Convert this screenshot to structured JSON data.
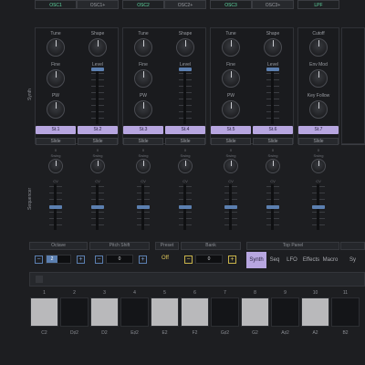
{
  "side_labels": {
    "synth": "Synth",
    "sequencer": "Sequencer"
  },
  "modules": [
    {
      "tabs": [
        "OSC1",
        "OSC1+"
      ],
      "active_tab": 0,
      "knobs": [
        "Tune",
        "Fine",
        "PW"
      ],
      "right_knob": "Shape",
      "right_fader": "Level",
      "steps": [
        "St.1",
        "St.2"
      ]
    },
    {
      "tabs": [
        "OSC2",
        "OSC2+"
      ],
      "active_tab": 0,
      "knobs": [
        "Tune",
        "Fine",
        "PW"
      ],
      "right_knob": "Shape",
      "right_fader": "Level",
      "steps": [
        "St.3",
        "St.4"
      ]
    },
    {
      "tabs": [
        "OSC3",
        "OSC3+"
      ],
      "active_tab": 0,
      "knobs": [
        "Tune",
        "Fine",
        "PW"
      ],
      "right_knob": "Shape",
      "right_fader": "Level",
      "steps": [
        "St.5",
        "St.6"
      ]
    },
    {
      "tabs": [
        "LPF"
      ],
      "active_tab": 0,
      "knobs": [
        "Cutoff",
        "Env Mod",
        "Key Follow"
      ],
      "steps": [
        "St.7"
      ]
    }
  ],
  "slide_label": "Slide",
  "seq_tiny_labels": {
    "top": "0",
    "sub": "Swing",
    "cv": "CV"
  },
  "bottom": {
    "octave_label": "Octave",
    "pitch_shift_label": "Pitch Shift",
    "preset_label": "Preset",
    "bank_label": "Bank",
    "top_panel_label": "Top Panel",
    "octave_value": "2",
    "pitch_value": "0",
    "preset_value": "Off",
    "bank_value": "0",
    "minus": "−",
    "plus": "+",
    "nav_tabs": [
      "Synth",
      "Seq",
      "LFO",
      "Effects",
      "Macro",
      "Sy"
    ],
    "active_nav": 0
  },
  "keyboard": {
    "numbers": [
      "1",
      "2",
      "3",
      "4",
      "5",
      "6",
      "7",
      "8",
      "9",
      "10",
      "11"
    ],
    "notes": [
      "C2",
      "D♯2",
      "D2",
      "E♯2",
      "E2",
      "F2",
      "G♯2",
      "G2",
      "A♯2",
      "A2",
      "B2"
    ],
    "colors": [
      "white",
      "black",
      "white",
      "black",
      "white",
      "white",
      "black",
      "white",
      "black",
      "white",
      "black"
    ]
  }
}
